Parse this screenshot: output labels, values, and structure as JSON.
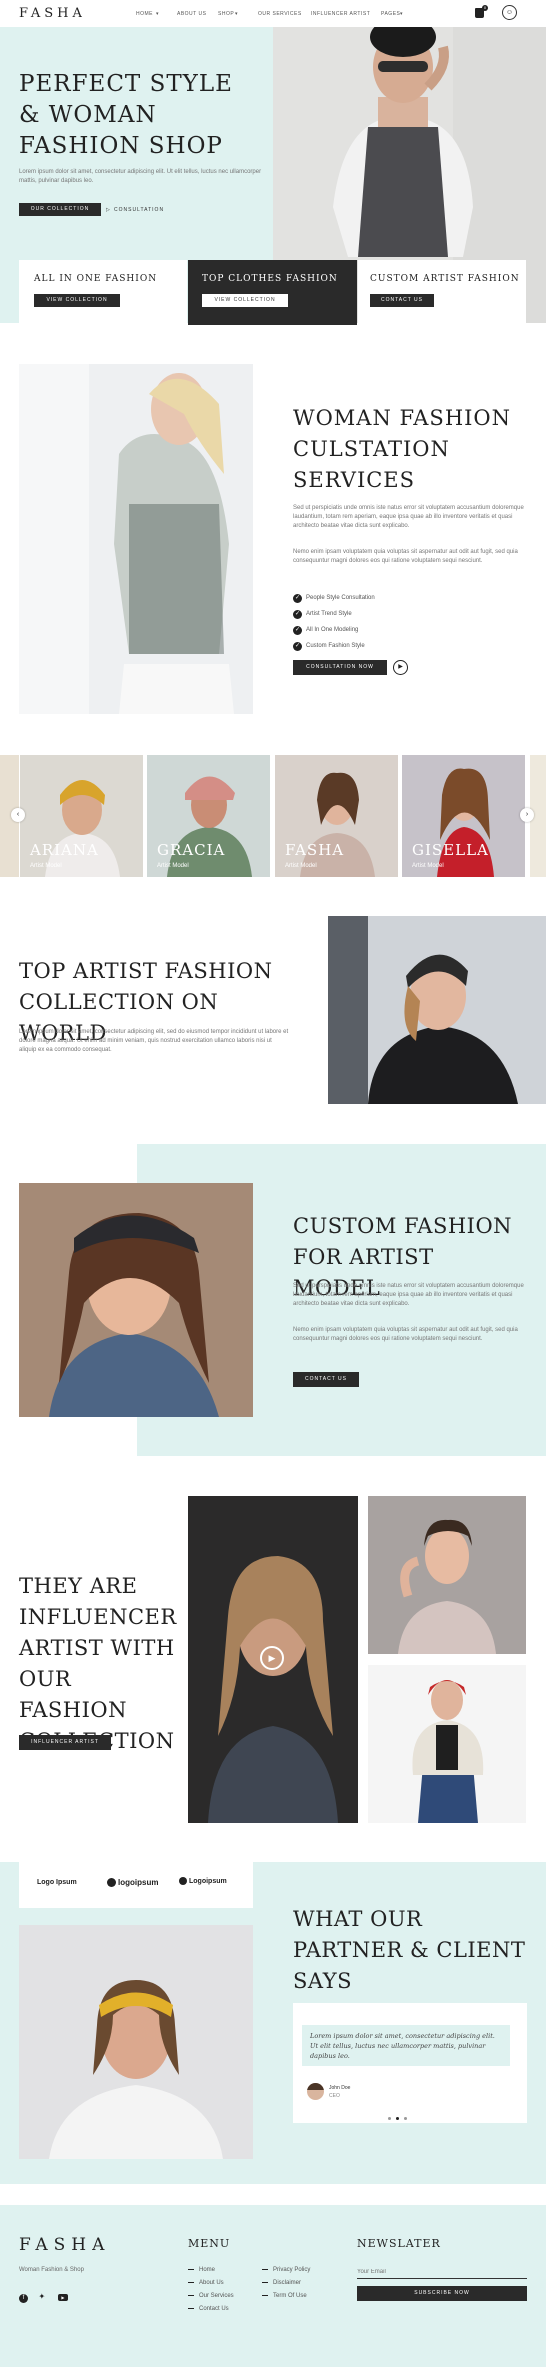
{
  "header": {
    "logo": "FASHA",
    "nav": [
      "HOME",
      "ABOUT US",
      "SHOP",
      "OUR SERVICES",
      "INFLUENCER ARTIST",
      "PAGES"
    ],
    "cart_count": "0"
  },
  "hero": {
    "title": "PERFECT STYLE & WOMAN FASHION SHOP",
    "text": "Lorem ipsum dolor sit amet, consectetur adipiscing elit. Ut elit tellus, luctus nec ullamcorper mattis, pulvinar dapibus leo.",
    "button": "OUR COLLECTION",
    "link": "CONSULTATION"
  },
  "boxes": [
    {
      "title": "ALL IN ONE FASHION",
      "button": "VIEW COLLECTION"
    },
    {
      "title": "TOP CLOTHES FASHION",
      "button": "VIEW COLLECTION"
    },
    {
      "title": "CUSTOM ARTIST FASHION",
      "button": "CONTACT US"
    }
  ],
  "services": {
    "title": "WOMAN FASHION CULSTATION SERVICES",
    "p1": "Sed ut perspiciatis unde omnis iste natus error sit voluptatem accusantium doloremque laudantium, totam rem aperiam, eaque ipsa quae ab illo inventore veritatis et quasi architecto beatae vitae dicta sunt explicabo.",
    "p2": "Nemo enim ipsam voluptatem quia voluptas sit aspernatur aut odit aut fugit, sed quia consequuntur magni dolores eos qui ratione voluptatem sequi nesciunt.",
    "items": [
      "People Style Consultation",
      "Artist Trend Style",
      "All In One Modeling",
      "Custom Fashion Style"
    ],
    "button": "CONSULTATION NOW"
  },
  "models": [
    {
      "name": "ARIANA",
      "role": "Artist Model"
    },
    {
      "name": "GRACIA",
      "role": "Artist Model"
    },
    {
      "name": "FASHA",
      "role": "Artist Model"
    },
    {
      "name": "GISELLA",
      "role": "Artist Model"
    }
  ],
  "collection": {
    "title": "TOP ARTIST FASHION COLLECTION ON WORLD",
    "text": "Lorem ipsum dolor sit amet, consectetur adipiscing elit, sed do eiusmod tempor incididunt ut labore et dolore magna aliqua. Ut enim ad minim veniam, quis nostrud exercitation ullamco laboris nisi ut aliquip ex ea commodo consequat."
  },
  "custom": {
    "title": "CUSTOM FASHION FOR ARTIST MODEL",
    "p1": "Sed ut perspiciatis unde omnis iste natus error sit voluptatem accusantium doloremque laudantium, totam rem aperiam, eaque ipsa quae ab illo inventore veritatis et quasi architecto beatae vitae dicta sunt explicabo.",
    "p2": "Nemo enim ipsam voluptatem quia voluptas sit aspernatur aut odit aut fugit, sed quia consequuntur magni dolores eos qui ratione voluptatem sequi nesciunt.",
    "button": "CONTACT US"
  },
  "influencer": {
    "title": "THEY ARE INFLUENCER ARTIST WITH OUR FASHION COLLECTION",
    "button": "INFLUENCER ARTIST"
  },
  "partners": {
    "logos": [
      "Logo Ipsum",
      "logoipsum",
      "Logoipsum"
    ],
    "title": "WHAT OUR PARTNER & CLIENT SAYS",
    "quote": "Lorem ipsum dolor sit amet, consectetur adipiscing elit. Ut elit tellus, luctus nec ullamcorper mattis, pulvinar dapibus leo.",
    "author": "John Doe",
    "role": "CEO"
  },
  "footer": {
    "logo": "FASHA",
    "tagline": "Woman Fashion & Shop",
    "menu_title": "MENU",
    "menu_col1": [
      "Home",
      "About Us",
      "Our Services",
      "Contact Us"
    ],
    "menu_col2": [
      "Privacy Policy",
      "Disclaimer",
      "Term Of Use"
    ],
    "news_title": "NEWSLATER",
    "email_placeholder": "Your Email",
    "subscribe": "SUBSCRIBE NOW"
  },
  "colors": {
    "mint": "#dff2f0",
    "dark": "#2a2a2a"
  }
}
